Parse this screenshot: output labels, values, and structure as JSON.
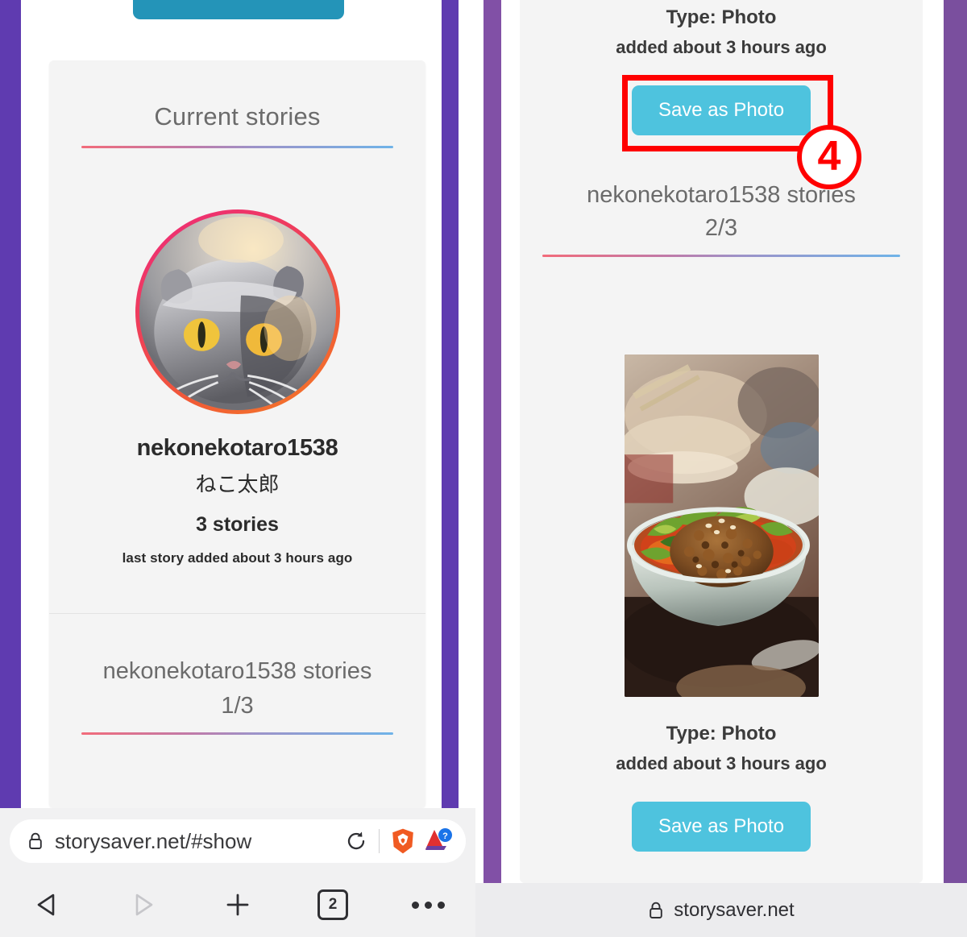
{
  "left_screen": {
    "top_button": {
      "label": ""
    },
    "card": {
      "title": "Current stories",
      "profile": {
        "username": "nekonekotaro1538",
        "fullname": "ねこ太郎",
        "story_count": "3 stories",
        "last_added": "last story added about 3 hours ago",
        "avatar_alt": "cat-avatar"
      },
      "stories_header": "nekonekotaro1538 stories",
      "stories_page": "1/3"
    },
    "browser": {
      "url": "storysaver.net/#show",
      "lock_icon": "lock-icon",
      "reload_icon": "reload-icon",
      "brave_icon": "brave-lion-icon",
      "extension_icon": "extension-help-icon",
      "nav": {
        "back": "back-icon",
        "forward": "forward-icon",
        "new_tab": "plus-icon",
        "tab_count": "2",
        "menu": "more-options-icon"
      }
    }
  },
  "right_screen": {
    "top_story": {
      "type": "Type: Photo",
      "added": "added about 3 hours ago",
      "save_label": "Save as Photo"
    },
    "stories_header": "nekonekotaro1538 stories",
    "stories_page": "2/3",
    "photo_alt": "noodle-bowl-photo",
    "bottom_story": {
      "type": "Type: Photo",
      "added": "added about 3 hours ago",
      "save_label": "Save as Photo"
    },
    "browser": {
      "url": "storysaver.net",
      "lock_icon": "lock-icon"
    }
  },
  "annotation": {
    "step_number": "4",
    "color": "#ff0000"
  },
  "colors": {
    "teal_button": "#4ec3de",
    "teal_button_dark": "#2494b8",
    "purple_left": "#5f3bb0",
    "purple_right": "#7a4f9e",
    "card_bg": "#f4f4f4",
    "annotation_red": "#ff0000"
  }
}
